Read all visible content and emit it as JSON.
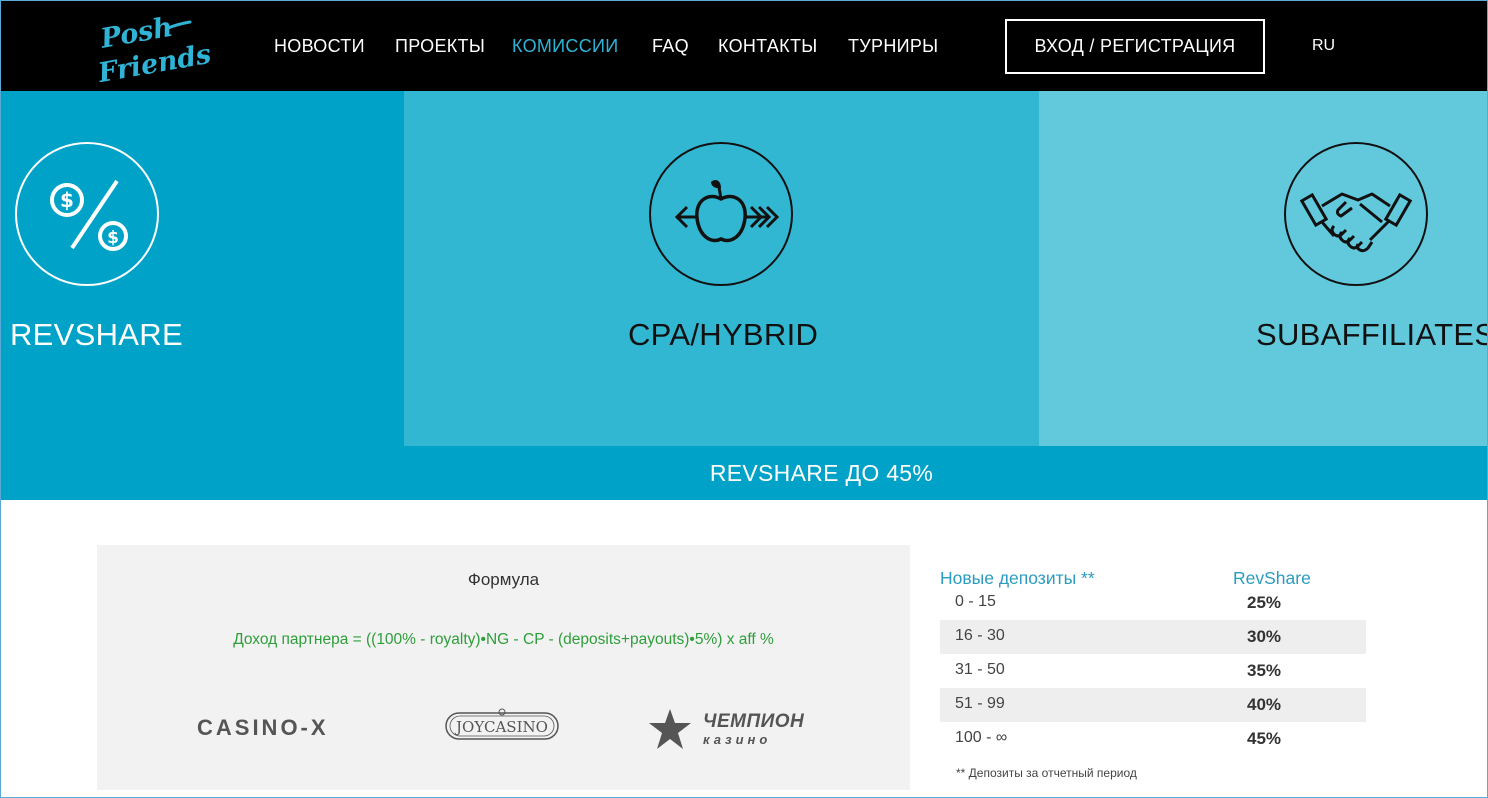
{
  "brand": {
    "logo_line1": "Posh",
    "logo_line2": "Friends",
    "accent": "#2fb4d6"
  },
  "nav": {
    "items": [
      {
        "label": "НОВОСТИ"
      },
      {
        "label": "ПРОЕКТЫ"
      },
      {
        "label": "КОМИССИИ",
        "active": true
      },
      {
        "label": "FAQ"
      },
      {
        "label": "КОНТАКТЫ"
      },
      {
        "label": "ТУРНИРЫ"
      }
    ],
    "login_label": "ВХОД / РЕГИСТРАЦИЯ",
    "lang": "RU"
  },
  "panels": [
    {
      "title": "REVSHARE",
      "icon": "dollar-percent-icon",
      "bg": "#00a3c7"
    },
    {
      "title": "CPA/HYBRID",
      "icon": "apple-arrow-icon",
      "bg": "#32b7d2"
    },
    {
      "title": "SUBAFFILIATES",
      "icon": "handshake-icon",
      "bg": "#62c9dd"
    }
  ],
  "bar_text": "REVSHARE ДО 45%",
  "formula": {
    "title": "Формула",
    "text": "Доход партнера = ((100% - royalty)•NG - CP - (deposits+payouts)•5%) x aff %",
    "logos": {
      "casinox": "CASINO-X",
      "joycasino": "JOYCASINO",
      "champion_line1": "ЧЕМПИОН",
      "champion_line2": "казино"
    }
  },
  "revshare_table": {
    "headers": [
      "Новые депозиты **",
      "RevShare"
    ],
    "rows": [
      {
        "range": "0 - 15",
        "pct": "25%"
      },
      {
        "range": "16 - 30",
        "pct": "30%"
      },
      {
        "range": "31 - 50",
        "pct": "35%"
      },
      {
        "range": "51 - 99",
        "pct": "40%"
      },
      {
        "range": "100 - ∞",
        "pct": "45%"
      }
    ],
    "footnote": "** Депозиты за отчетный период"
  }
}
